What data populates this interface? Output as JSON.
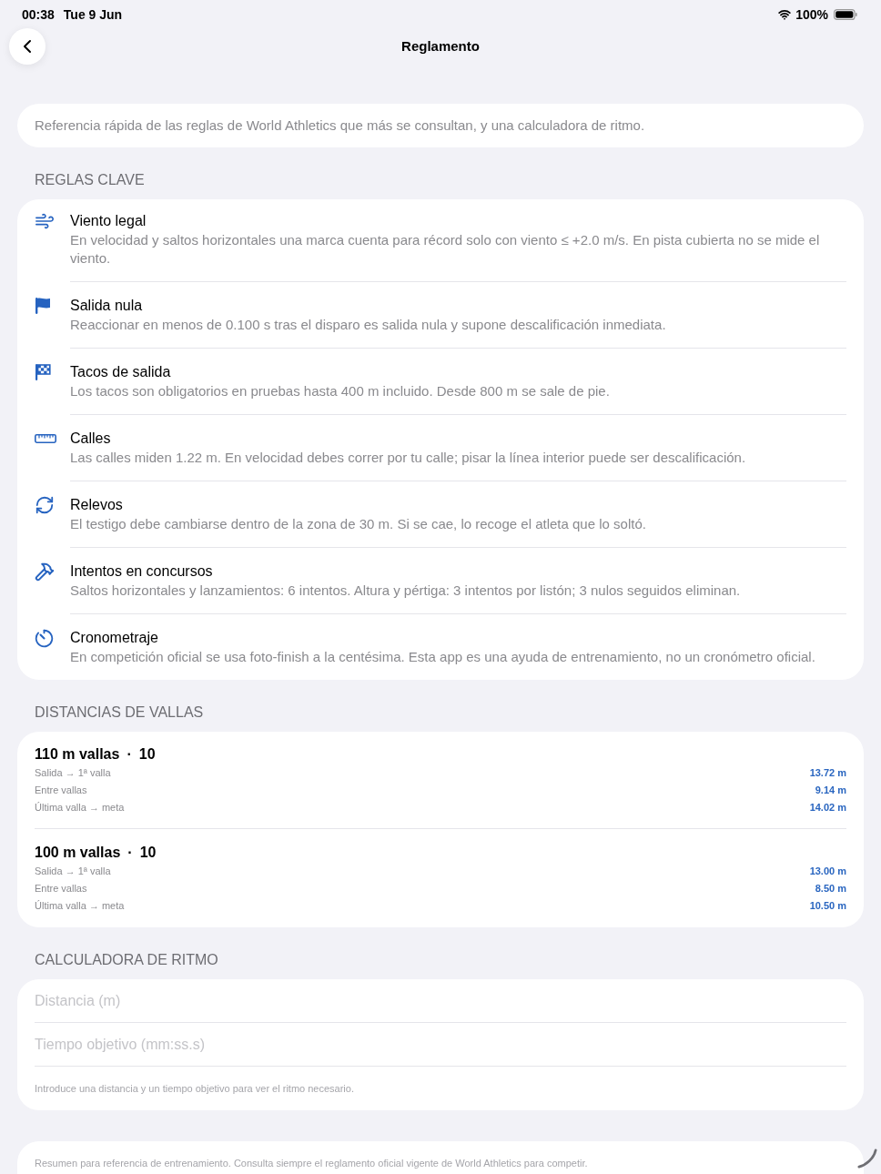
{
  "status_bar": {
    "time": "00:38",
    "date": "Tue 9 Jun",
    "battery": "100%"
  },
  "nav": {
    "title": "Reglamento"
  },
  "intro": "Referencia rápida de las reglas de World Athletics que más se consultan, y una calculadora de ritmo.",
  "rules_section": {
    "header": "REGLAS CLAVE",
    "items": [
      {
        "title": "Viento legal",
        "text": "En velocidad y saltos horizontales una marca cuenta para récord solo con viento ≤ +2.0 m/s. En pista cubierta no se mide el viento."
      },
      {
        "title": "Salida nula",
        "text": "Reaccionar en menos de 0.100 s tras el disparo es salida nula y supone descalificación inmediata."
      },
      {
        "title": "Tacos de salida",
        "text": "Los tacos son obligatorios en pruebas hasta 400 m incluido. Desde 800 m se sale de pie."
      },
      {
        "title": "Calles",
        "text": "Las calles miden 1.22 m. En velocidad debes correr por tu calle; pisar la línea interior puede ser descalificación."
      },
      {
        "title": "Relevos",
        "text": "El testigo debe cambiarse dentro de la zona de 30 m. Si se cae, lo recoge el atleta que lo soltó."
      },
      {
        "title": "Intentos en concursos",
        "text": "Saltos horizontales y lanzamientos: 6 intentos. Altura y pértiga: 3 intentos por listón; 3 nulos seguidos eliminan."
      },
      {
        "title": "Cronometraje",
        "text": "En competición oficial se usa foto-finish a la centésima. Esta app es una ayuda de entrenamiento, no un cronómetro oficial."
      }
    ]
  },
  "hurdles_section": {
    "header": "DISTANCIAS DE VALLAS",
    "events": [
      {
        "title": "110 m vallas",
        "separator": "·",
        "count": "10",
        "rows": [
          {
            "label": "Salida → 1ª valla",
            "value": "13.72 m"
          },
          {
            "label": "Entre vallas",
            "value": "9.14 m"
          },
          {
            "label": "Última valla → meta",
            "value": "14.02 m"
          }
        ]
      },
      {
        "title": "100 m vallas",
        "separator": "·",
        "count": "10",
        "rows": [
          {
            "label": "Salida → 1ª valla",
            "value": "13.00 m"
          },
          {
            "label": "Entre vallas",
            "value": "8.50 m"
          },
          {
            "label": "Última valla → meta",
            "value": "10.50 m"
          }
        ]
      }
    ]
  },
  "pace_calculator": {
    "header": "CALCULADORA DE RITMO",
    "fields": [
      {
        "placeholder": "Distancia (m)"
      },
      {
        "placeholder": "Tiempo objetivo (mm:ss.s)"
      }
    ],
    "hint": "Introduce una distancia y un tiempo objetivo para ver el ritmo necesario."
  },
  "footer_note": "Resumen para referencia de entrenamiento. Consulta siempre el reglamento oficial vigente de World Athletics para competir."
}
